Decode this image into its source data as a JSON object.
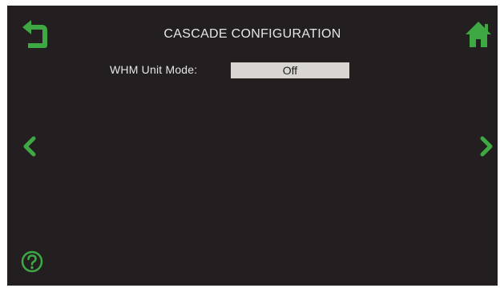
{
  "header": {
    "title": "CASCADE CONFIGURATION"
  },
  "settings": {
    "whm_unit_mode": {
      "label": "WHM Unit Mode:",
      "value": "Off"
    }
  },
  "icons": {
    "back": "back-arrow-icon",
    "home": "home-icon",
    "previous": "chevron-left-icon",
    "next": "chevron-right-icon",
    "help": "help-icon"
  },
  "colors": {
    "background": "#231f20",
    "accent": "#3ea843",
    "text": "#e6e6e6",
    "field": "#d9d6d2"
  }
}
